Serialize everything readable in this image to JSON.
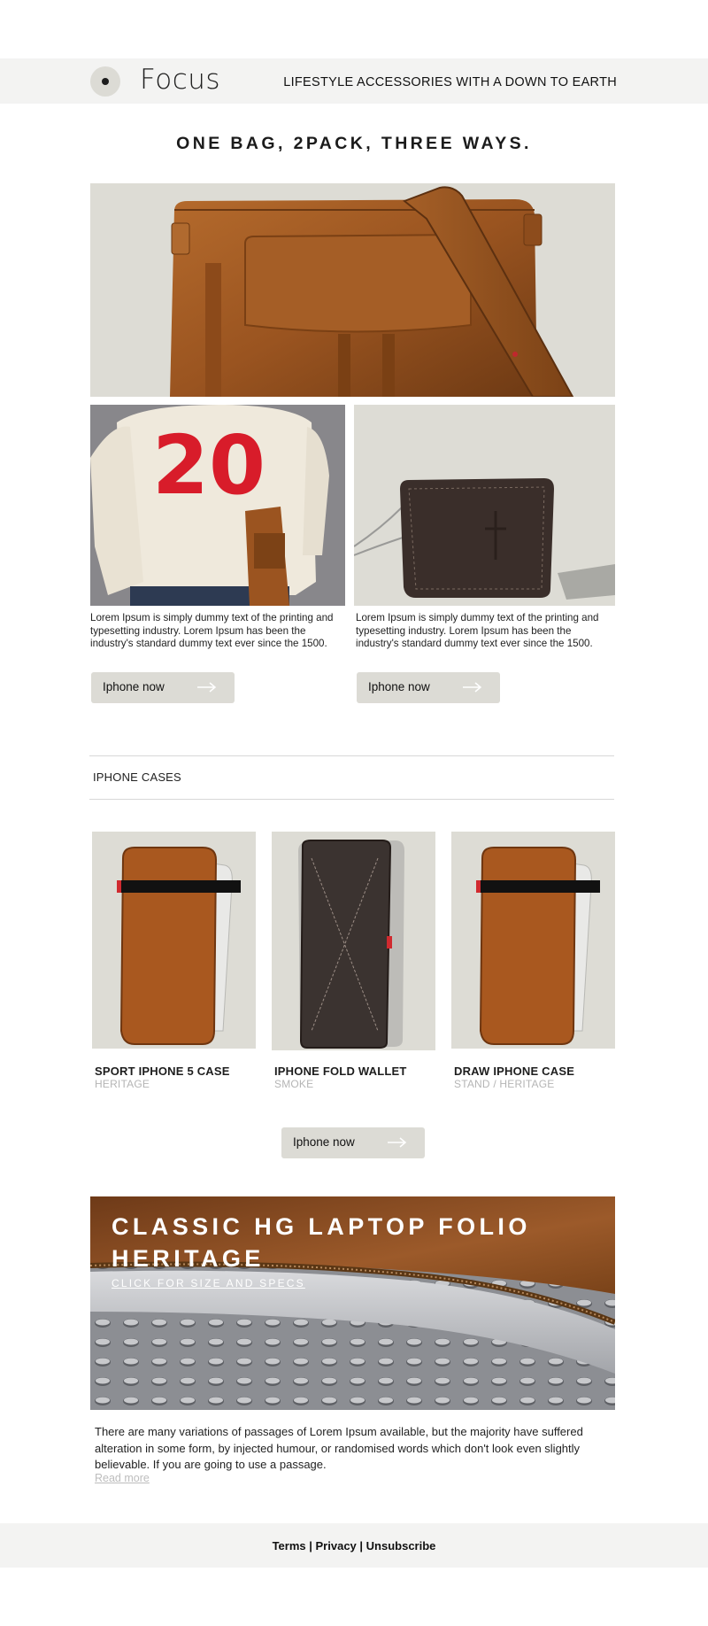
{
  "header": {
    "logo_text": "Focus",
    "tagline": "LIFESTYLE ACCESSORIES WITH A DOWN TO EARTH"
  },
  "headline": "ONE BAG, 2PACK, THREE WAYS.",
  "features": [
    {
      "description": "Lorem Ipsum is simply dummy text of the printing and typesetting industry. Lorem Ipsum has been the industry's standard dummy text ever since the 1500.",
      "button_label": "Iphone now"
    },
    {
      "description": "Lorem Ipsum is simply dummy text of the printing and typesetting industry. Lorem Ipsum has been the industry's standard dummy text ever since the 1500.",
      "button_label": "Iphone now"
    }
  ],
  "sweater_number": "20",
  "section_title": "IPHONE CASES",
  "products": [
    {
      "name": "SPORT IPHONE 5 CASE",
      "subtitle": "HERITAGE"
    },
    {
      "name": "IPHONE FOLD WALLET",
      "subtitle": "SMOKE"
    },
    {
      "name": "DRAW IPHONE CASE",
      "subtitle": "STAND / HERITAGE"
    }
  ],
  "cases_button_label": "Iphone now",
  "folio": {
    "title_line1": "CLASSIC HG LAPTOP FOLIO",
    "title_line2": "HERITAGE",
    "link": "CLICK FOR SIZE AND SPECS"
  },
  "body_text": "There are many variations of passages of Lorem Ipsum available, but the majority have suffered alteration in some form, by injected humour, or randomised words which don't look even slightly believable. If you are going to use a passage.",
  "read_more": "Read more",
  "footer": {
    "terms": "Terms",
    "privacy": "Privacy",
    "unsubscribe": "Unsubscribe",
    "separator": " | "
  }
}
